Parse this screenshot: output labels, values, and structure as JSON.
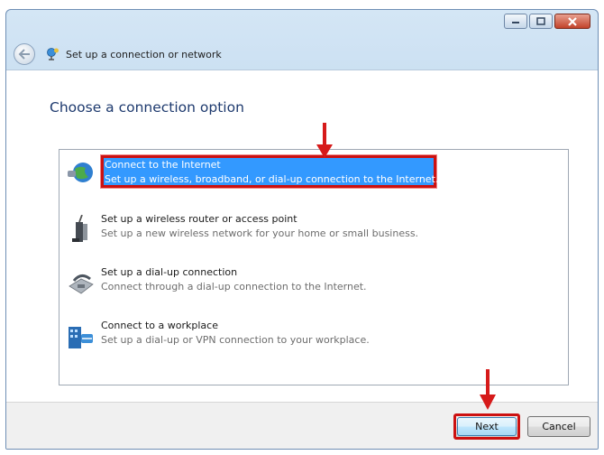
{
  "window": {
    "title": "Set up a connection or network",
    "controls": {
      "minimize": "minimize-icon",
      "maximize": "maximize-icon",
      "close": "close-icon"
    }
  },
  "main": {
    "heading": "Choose a connection option",
    "options": [
      {
        "title": "Connect to the Internet",
        "description": "Set up a wireless, broadband, or dial-up connection to the Internet.",
        "icon": "globe-network-icon",
        "selected": true
      },
      {
        "title": "Set up a wireless router or access point",
        "description": "Set up a new wireless network for your home or small business.",
        "icon": "wireless-router-icon",
        "selected": false
      },
      {
        "title": "Set up a dial-up connection",
        "description": "Connect through a dial-up connection to the Internet.",
        "icon": "dialup-modem-icon",
        "selected": false
      },
      {
        "title": "Connect to a workplace",
        "description": "Set up a dial-up or VPN connection to your workplace.",
        "icon": "workplace-connection-icon",
        "selected": false
      }
    ]
  },
  "footer": {
    "next_label": "Next",
    "cancel_label": "Cancel"
  },
  "colors": {
    "selection": "#3399ff",
    "annotation": "#cc1111",
    "heading": "#1e3a6e"
  }
}
